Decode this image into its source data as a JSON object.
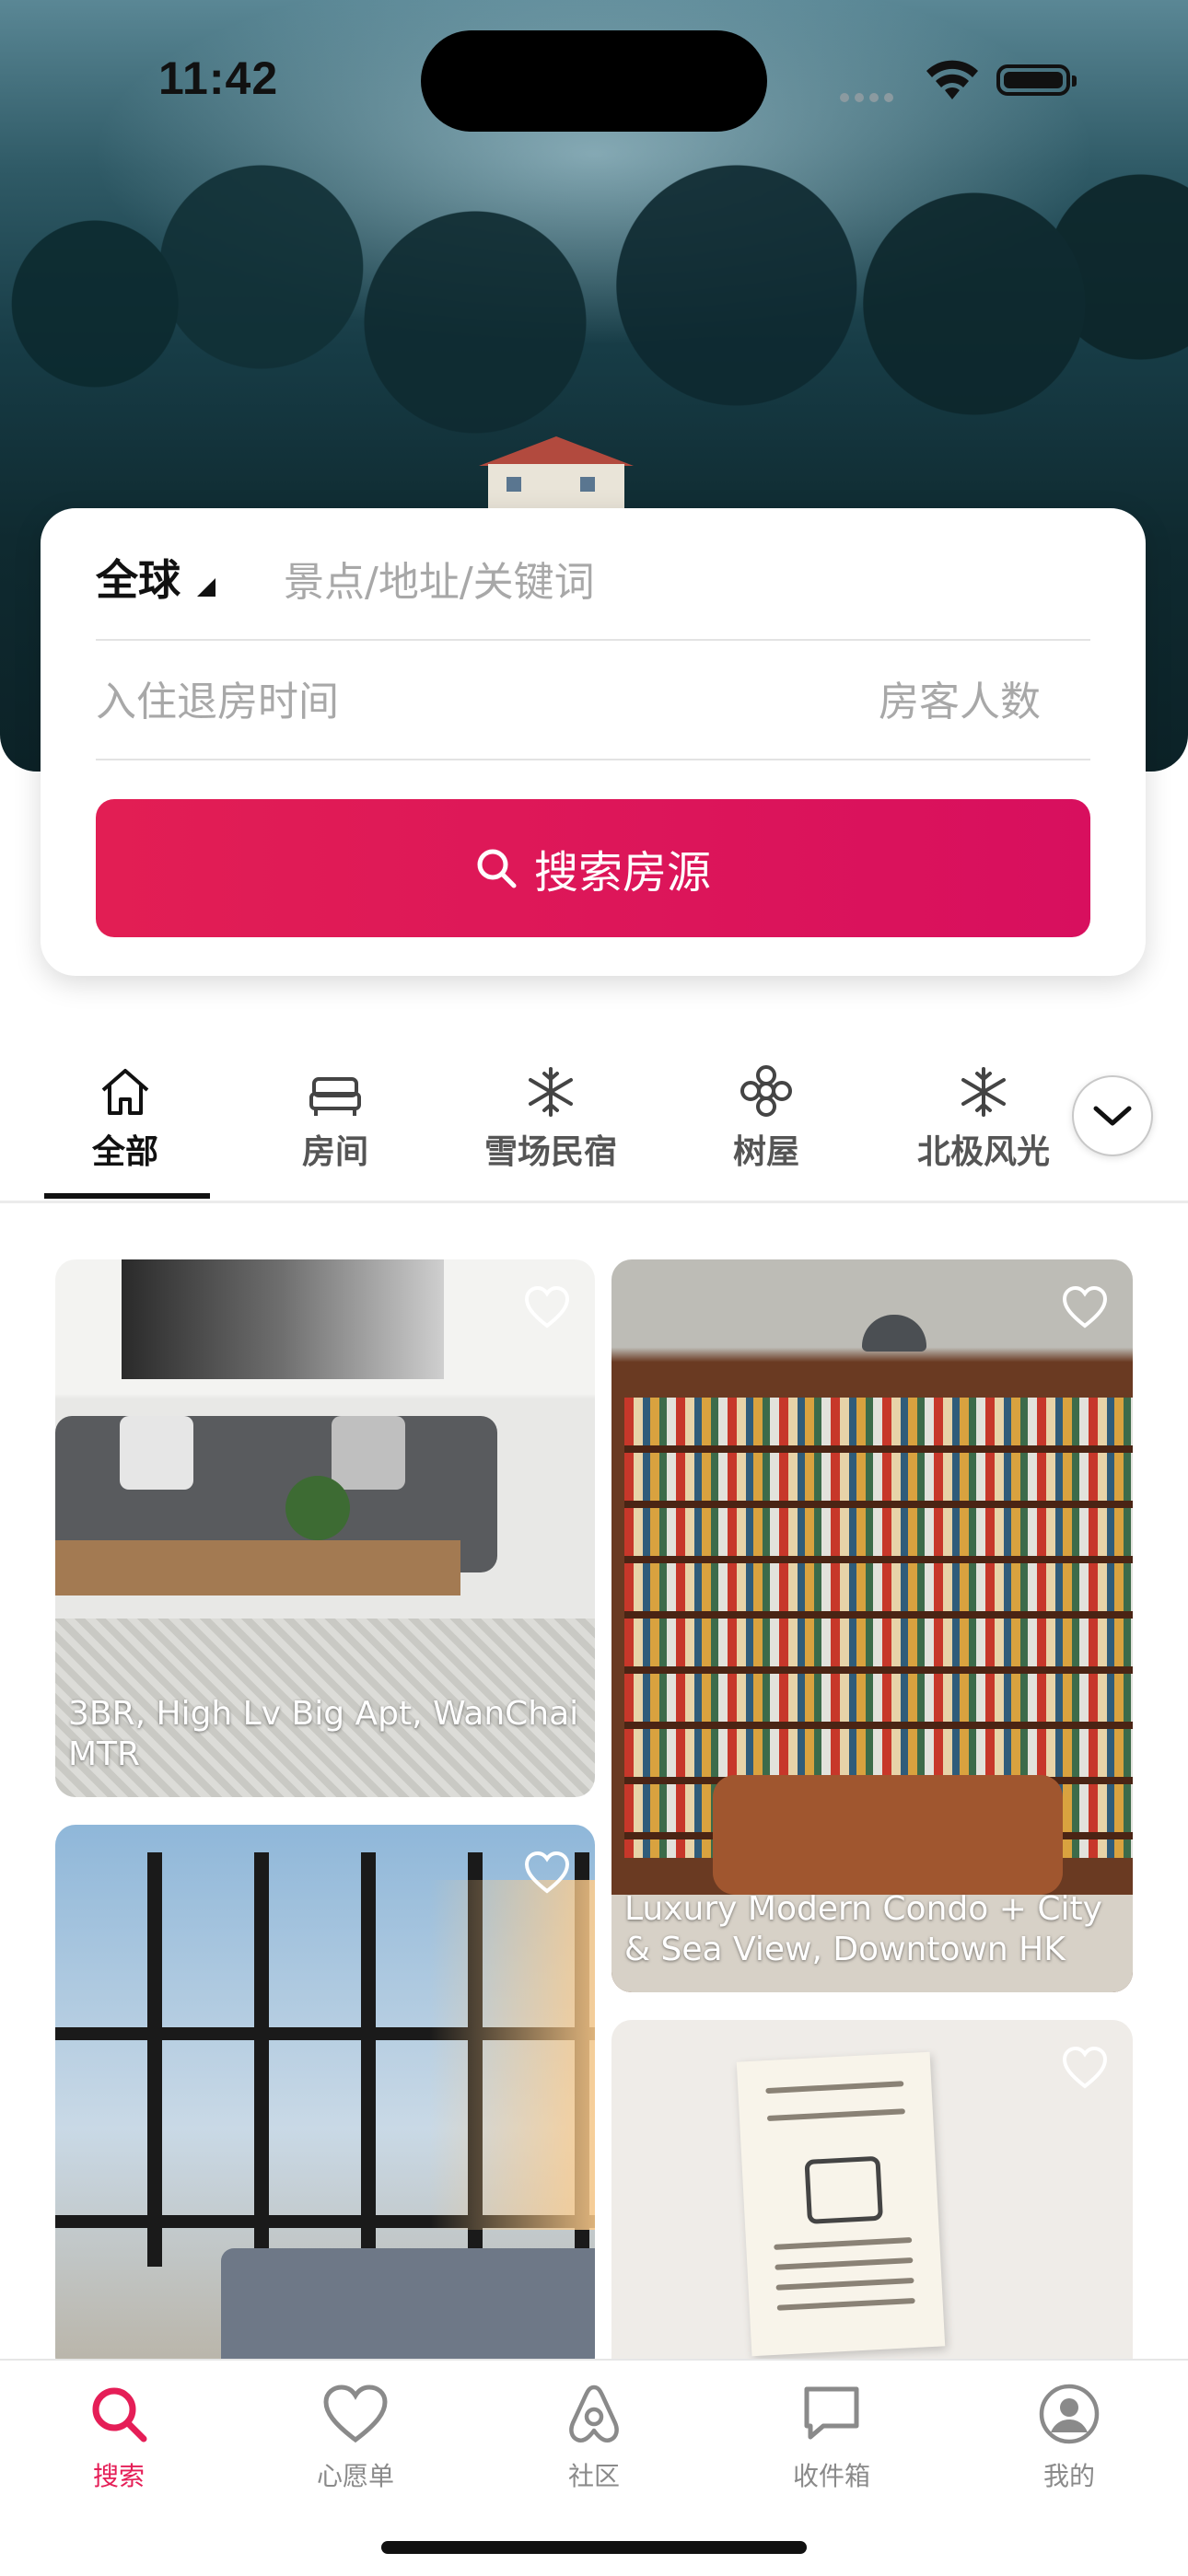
{
  "status_bar": {
    "time": "11:42"
  },
  "search_card": {
    "region": "全球",
    "keyword_placeholder": "景点/地址/关键词",
    "dates_placeholder": "入住退房时间",
    "guests_placeholder": "房客人数",
    "search_button_label": "搜索房源",
    "accent_color": "#e21e54"
  },
  "categories": [
    {
      "label": "全部",
      "icon": "home-icon",
      "active": true
    },
    {
      "label": "房间",
      "icon": "bed-icon"
    },
    {
      "label": "雪场民宿",
      "icon": "snowflake-icon"
    },
    {
      "label": "树屋",
      "icon": "flower-icon"
    },
    {
      "label": "北极风光",
      "icon": "snowflake-icon"
    }
  ],
  "listings": [
    {
      "title": "3BR, High Lv Big Apt, WanChai MTR"
    },
    {
      "title": "Luxury Modern Condo + City & Sea View, Downtown HK"
    },
    {
      "title": ""
    },
    {
      "title": ""
    }
  ],
  "tabbar": {
    "items": [
      {
        "label": "搜索",
        "icon": "search-icon",
        "active": true
      },
      {
        "label": "心愿单",
        "icon": "heart-icon"
      },
      {
        "label": "社区",
        "icon": "airbnb-logo-icon"
      },
      {
        "label": "收件箱",
        "icon": "chat-icon"
      },
      {
        "label": "我的",
        "icon": "profile-icon"
      }
    ],
    "active_color": "#e51e57"
  }
}
